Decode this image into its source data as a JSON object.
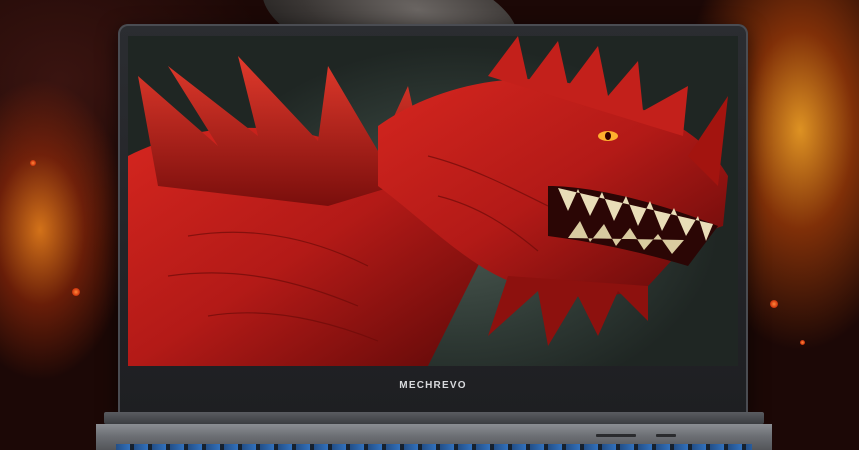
{
  "brand": {
    "logo_text": "MECHREVO"
  },
  "colors": {
    "dragon_red": "#b31a17",
    "dragon_dark": "#5e0908",
    "fire_orange": "#ff9a2a",
    "laptop_gray": "#2b2d31",
    "keyboard_blue": "#2d74c9"
  }
}
